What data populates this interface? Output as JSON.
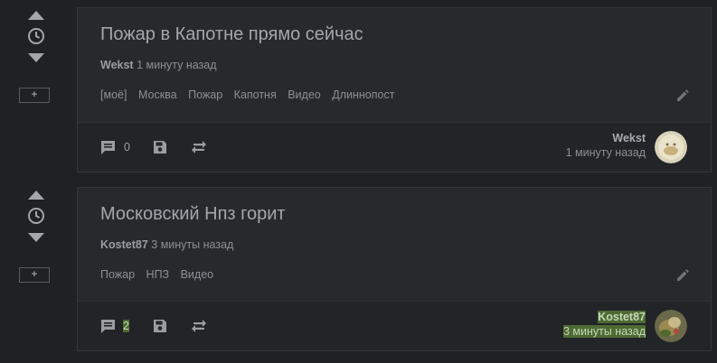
{
  "posts": [
    {
      "title": "Пожар в Капотне прямо сейчас",
      "author": "Wekst",
      "time": "1 минуту назад",
      "tags": [
        "[моё]",
        "Москва",
        "Пожар",
        "Капотня",
        "Видео",
        "Длиннопост"
      ],
      "comments": "0",
      "footer_author": "Wekst",
      "footer_time": "1 минуту назад",
      "rail": {
        "plus_label": "+"
      },
      "avatar_icon": "avatar-image",
      "highlighted": false
    },
    {
      "title": "Московский Нпз горит",
      "author": "Kostet87",
      "time": "3 минуты назад",
      "tags": [
        "Пожар",
        "НПЗ",
        "Видео"
      ],
      "comments": "2",
      "footer_author": "Kostet87",
      "footer_time": "3 минуты назад",
      "rail": {
        "plus_label": "+"
      },
      "avatar_icon": "avatar-image",
      "highlighted": true
    }
  ],
  "colors": {
    "background": "#1f2125",
    "card": "#27292d",
    "highlight": "#4d6b33"
  },
  "icons": [
    "arrow-up-icon",
    "clock-icon",
    "arrow-down-icon",
    "comment-icon",
    "save-icon",
    "repeat-icon",
    "pencil-icon"
  ]
}
